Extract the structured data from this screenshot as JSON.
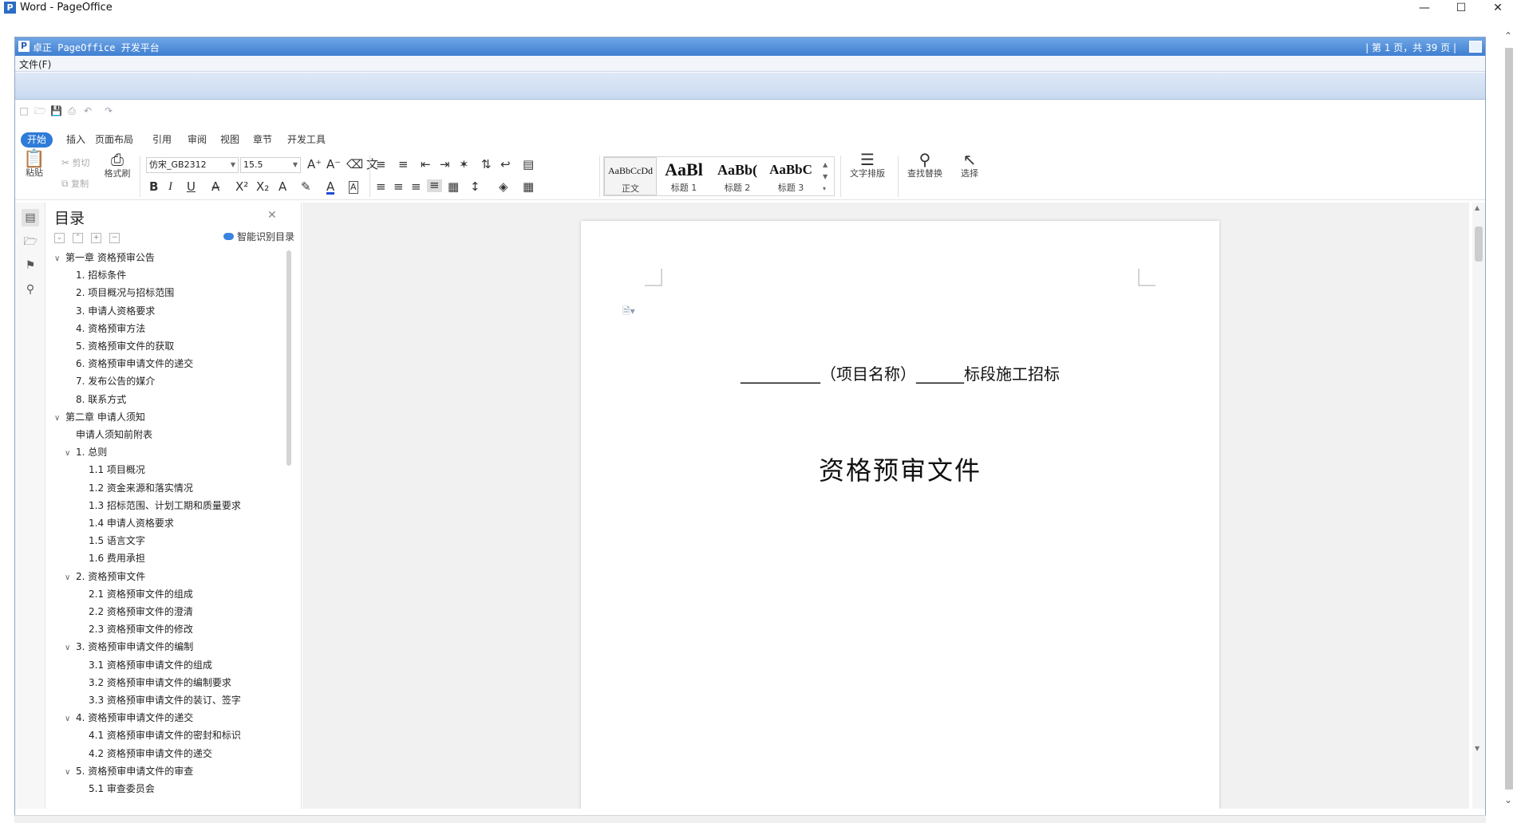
{
  "window": {
    "title": "Word - PageOffice",
    "icon": "P"
  },
  "po": {
    "caption": "卓正 PageOffice 开发平台",
    "page_info": "| 第 1 页，共 39 页 |",
    "menu_file": "文件(F)"
  },
  "ribbon_tabs": [
    "开始",
    "插入",
    "页面布局",
    "引用",
    "审阅",
    "视图",
    "章节",
    "开发工具"
  ],
  "ribbon": {
    "paste": "粘贴",
    "cut": "剪切",
    "copy": "复制",
    "format_painter": "格式刷",
    "font_name": "仿宋_GB2312",
    "font_size": "15.5",
    "styles": [
      {
        "preview": "AaBbCcDd",
        "label": "正文"
      },
      {
        "preview": "AaBl",
        "label": "标题 1"
      },
      {
        "preview": "AaBb(",
        "label": "标题 2"
      },
      {
        "preview": "AaBbC",
        "label": "标题 3"
      }
    ],
    "text_layout": "文字排版",
    "find_replace": "查找替换",
    "select": "选择"
  },
  "toc": {
    "title": "目录",
    "smart": "智能识别目录",
    "items": [
      {
        "level": 0,
        "text": "第一章 资格预审公告",
        "chev": true
      },
      {
        "level": 1,
        "text": "1. 招标条件"
      },
      {
        "level": 1,
        "text": "2. 项目概况与招标范围"
      },
      {
        "level": 1,
        "text": "3. 申请人资格要求"
      },
      {
        "level": 1,
        "text": "4. 资格预审方法"
      },
      {
        "level": 1,
        "text": "5. 资格预审文件的获取"
      },
      {
        "level": 1,
        "text": "6. 资格预审申请文件的递交"
      },
      {
        "level": 1,
        "text": "7. 发布公告的媒介"
      },
      {
        "level": 1,
        "text": "8. 联系方式"
      },
      {
        "level": 0,
        "text": "第二章 申请人须知",
        "chev": true
      },
      {
        "level": 1,
        "text": "申请人须知前附表"
      },
      {
        "level": 1,
        "text": "1. 总则",
        "chev": true
      },
      {
        "level": 2,
        "text": "1.1 项目概况"
      },
      {
        "level": 2,
        "text": "1.2 资金来源和落实情况"
      },
      {
        "level": 2,
        "text": "1.3 招标范围、计划工期和质量要求"
      },
      {
        "level": 2,
        "text": "1.4 申请人资格要求"
      },
      {
        "level": 2,
        "text": "1.5 语言文字"
      },
      {
        "level": 2,
        "text": "1.6 费用承担"
      },
      {
        "level": 1,
        "text": "2. 资格预审文件",
        "chev": true
      },
      {
        "level": 2,
        "text": "2.1 资格预审文件的组成"
      },
      {
        "level": 2,
        "text": "2.2 资格预审文件的澄清"
      },
      {
        "level": 2,
        "text": "2.3 资格预审文件的修改"
      },
      {
        "level": 1,
        "text": "3. 资格预审申请文件的编制",
        "chev": true
      },
      {
        "level": 2,
        "text": "3.1 资格预审申请文件的组成"
      },
      {
        "level": 2,
        "text": "3.2 资格预审申请文件的编制要求"
      },
      {
        "level": 2,
        "text": "3.3 资格预审申请文件的装订、签字"
      },
      {
        "level": 1,
        "text": "4. 资格预审申请文件的递交",
        "chev": true
      },
      {
        "level": 2,
        "text": "4.1 资格预审申请文件的密封和标识"
      },
      {
        "level": 2,
        "text": "4.2 资格预审申请文件的递交"
      },
      {
        "level": 1,
        "text": "5. 资格预审申请文件的审查",
        "chev": true
      },
      {
        "level": 2,
        "text": "5.1 审查委员会"
      }
    ]
  },
  "doc": {
    "line1": "__________（项目名称）______标段施工招标",
    "line2": "资格预审文件"
  },
  "colors": {
    "accent": "#2e7bd8",
    "po_title": "#3f7fd1"
  }
}
